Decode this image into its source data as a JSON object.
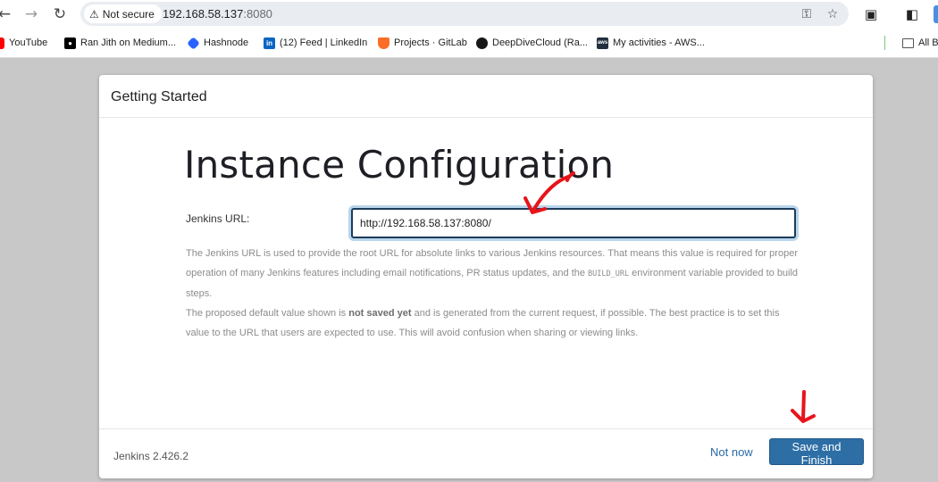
{
  "browser": {
    "security_label": "Not secure",
    "url_host": "192.168.58.137",
    "url_port": ":8080",
    "back_icon": "arrow-left-icon",
    "forward_icon": "arrow-right-icon",
    "reload_icon": "reload-icon"
  },
  "bookmarks": {
    "items": [
      {
        "label": "YouTube",
        "icon": "youtube-icon",
        "color": "#ff0000"
      },
      {
        "label": "Ran Jith on Medium...",
        "icon": "medium-icon",
        "color": "#000000"
      },
      {
        "label": "Hashnode",
        "icon": "hashnode-icon",
        "color": "#2962ff"
      },
      {
        "label": "(12) Feed | LinkedIn",
        "icon": "linkedin-icon",
        "color": "#0a66c2"
      },
      {
        "label": "Projects · GitLab",
        "icon": "gitlab-icon",
        "color": "#fc6d26"
      },
      {
        "label": "DeepDiveCloud (Ra...",
        "icon": "github-icon",
        "color": "#181717"
      },
      {
        "label": "My activities - AWS...",
        "icon": "aws-icon",
        "color": "#232f3e"
      }
    ],
    "all_bookmarks_label": "All Bo"
  },
  "dialog": {
    "title": "Getting Started",
    "heading": "Instance Configuration",
    "field_label": "Jenkins URL:",
    "field_value": "http://192.168.58.137:8080/",
    "help_p1_text": "The Jenkins URL is used to provide the root URL for absolute links to various Jenkins resources. That means this value is required for proper operation of many Jenkins features including email notifications, PR status updates, and the ",
    "help_p1_code": "BUILD_URL",
    "help_p1_end": " environment variable provided to build steps.",
    "help_p2_start": "The proposed default value shown is ",
    "help_p2_bold": "not saved yet",
    "help_p2_end": " and is generated from the current request, if possible. The best practice is to set this value to the URL that users are expected to use. This will avoid confusion when sharing or viewing links.",
    "version": "Jenkins 2.426.2",
    "not_now_label": "Not now",
    "save_label": "Save and Finish"
  },
  "colors": {
    "primary_button": "#2d6ea5",
    "link": "#2a6aa8",
    "annotation": "#e8141b"
  }
}
